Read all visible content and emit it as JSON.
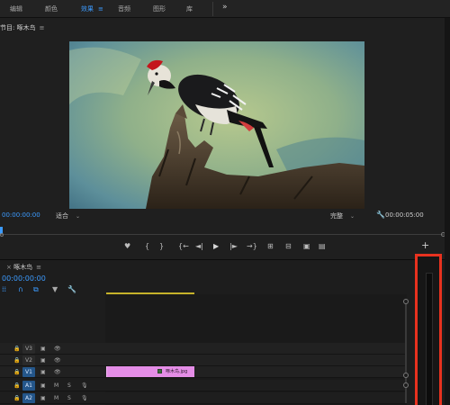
{
  "workspace_tabs": [
    {
      "label": "编辑",
      "active": false
    },
    {
      "label": "颜色",
      "active": false
    },
    {
      "label": "效果",
      "active": true
    },
    {
      "label": "音频",
      "active": false
    },
    {
      "label": "图形",
      "active": false
    },
    {
      "label": "库",
      "active": false
    }
  ],
  "more_label": "»",
  "program": {
    "title": "节目: 啄木鸟",
    "menu_icon": "≡",
    "timecode_left": "00:00:00:00",
    "fit_label": "适合",
    "quality_label": "完整",
    "timecode_right": "00:00:05:00",
    "transport": {
      "marker": "♥",
      "in_bracket": "{",
      "out_bracket": "}",
      "go_in": "{←",
      "step_back": "◄|",
      "play": "▶",
      "step_fwd": "|►",
      "go_out": "→}",
      "lift": "⊞",
      "extract": "⊟",
      "camera": "▣",
      "compare": "▤",
      "add": "+"
    }
  },
  "sequence": {
    "close_icon": "×",
    "title": "啄木鸟",
    "menu_icon": "≡",
    "timecode": "00:00:00:00",
    "tools": {
      "snap": "⁞⁞",
      "link": "∩",
      "linked": "⧉",
      "marker": "▼",
      "settings": "🔧"
    },
    "tracks": [
      {
        "name": "V3",
        "type": "video",
        "selected": false
      },
      {
        "name": "V2",
        "type": "video",
        "selected": false
      },
      {
        "name": "V1",
        "type": "video",
        "selected": true
      },
      {
        "name": "A1",
        "type": "audio",
        "selected": true
      },
      {
        "name": "A2",
        "type": "audio",
        "selected": true
      }
    ],
    "track_icons": {
      "lock": "🔒",
      "film": "▣",
      "eye": "👁",
      "mute": "M",
      "solo": "S",
      "mic": "🎙"
    },
    "clip": {
      "name": "啄木鸟.jpg",
      "color": "#e48de6"
    }
  },
  "highlight_color": "#e8321f",
  "accent_color": "#3c9bff"
}
